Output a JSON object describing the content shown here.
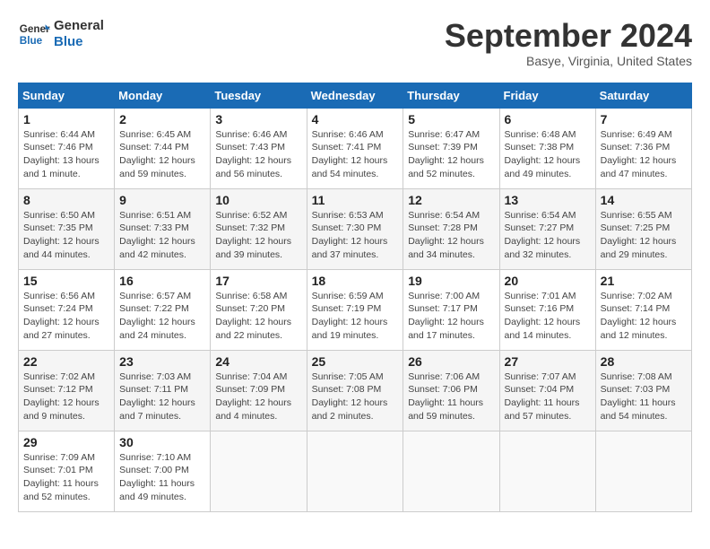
{
  "header": {
    "logo_line1": "General",
    "logo_line2": "Blue",
    "month": "September 2024",
    "location": "Basye, Virginia, United States"
  },
  "weekdays": [
    "Sunday",
    "Monday",
    "Tuesday",
    "Wednesday",
    "Thursday",
    "Friday",
    "Saturday"
  ],
  "weeks": [
    [
      {
        "day": "1",
        "detail": "Sunrise: 6:44 AM\nSunset: 7:46 PM\nDaylight: 13 hours\nand 1 minute."
      },
      {
        "day": "2",
        "detail": "Sunrise: 6:45 AM\nSunset: 7:44 PM\nDaylight: 12 hours\nand 59 minutes."
      },
      {
        "day": "3",
        "detail": "Sunrise: 6:46 AM\nSunset: 7:43 PM\nDaylight: 12 hours\nand 56 minutes."
      },
      {
        "day": "4",
        "detail": "Sunrise: 6:46 AM\nSunset: 7:41 PM\nDaylight: 12 hours\nand 54 minutes."
      },
      {
        "day": "5",
        "detail": "Sunrise: 6:47 AM\nSunset: 7:39 PM\nDaylight: 12 hours\nand 52 minutes."
      },
      {
        "day": "6",
        "detail": "Sunrise: 6:48 AM\nSunset: 7:38 PM\nDaylight: 12 hours\nand 49 minutes."
      },
      {
        "day": "7",
        "detail": "Sunrise: 6:49 AM\nSunset: 7:36 PM\nDaylight: 12 hours\nand 47 minutes."
      }
    ],
    [
      {
        "day": "8",
        "detail": "Sunrise: 6:50 AM\nSunset: 7:35 PM\nDaylight: 12 hours\nand 44 minutes."
      },
      {
        "day": "9",
        "detail": "Sunrise: 6:51 AM\nSunset: 7:33 PM\nDaylight: 12 hours\nand 42 minutes."
      },
      {
        "day": "10",
        "detail": "Sunrise: 6:52 AM\nSunset: 7:32 PM\nDaylight: 12 hours\nand 39 minutes."
      },
      {
        "day": "11",
        "detail": "Sunrise: 6:53 AM\nSunset: 7:30 PM\nDaylight: 12 hours\nand 37 minutes."
      },
      {
        "day": "12",
        "detail": "Sunrise: 6:54 AM\nSunset: 7:28 PM\nDaylight: 12 hours\nand 34 minutes."
      },
      {
        "day": "13",
        "detail": "Sunrise: 6:54 AM\nSunset: 7:27 PM\nDaylight: 12 hours\nand 32 minutes."
      },
      {
        "day": "14",
        "detail": "Sunrise: 6:55 AM\nSunset: 7:25 PM\nDaylight: 12 hours\nand 29 minutes."
      }
    ],
    [
      {
        "day": "15",
        "detail": "Sunrise: 6:56 AM\nSunset: 7:24 PM\nDaylight: 12 hours\nand 27 minutes."
      },
      {
        "day": "16",
        "detail": "Sunrise: 6:57 AM\nSunset: 7:22 PM\nDaylight: 12 hours\nand 24 minutes."
      },
      {
        "day": "17",
        "detail": "Sunrise: 6:58 AM\nSunset: 7:20 PM\nDaylight: 12 hours\nand 22 minutes."
      },
      {
        "day": "18",
        "detail": "Sunrise: 6:59 AM\nSunset: 7:19 PM\nDaylight: 12 hours\nand 19 minutes."
      },
      {
        "day": "19",
        "detail": "Sunrise: 7:00 AM\nSunset: 7:17 PM\nDaylight: 12 hours\nand 17 minutes."
      },
      {
        "day": "20",
        "detail": "Sunrise: 7:01 AM\nSunset: 7:16 PM\nDaylight: 12 hours\nand 14 minutes."
      },
      {
        "day": "21",
        "detail": "Sunrise: 7:02 AM\nSunset: 7:14 PM\nDaylight: 12 hours\nand 12 minutes."
      }
    ],
    [
      {
        "day": "22",
        "detail": "Sunrise: 7:02 AM\nSunset: 7:12 PM\nDaylight: 12 hours\nand 9 minutes."
      },
      {
        "day": "23",
        "detail": "Sunrise: 7:03 AM\nSunset: 7:11 PM\nDaylight: 12 hours\nand 7 minutes."
      },
      {
        "day": "24",
        "detail": "Sunrise: 7:04 AM\nSunset: 7:09 PM\nDaylight: 12 hours\nand 4 minutes."
      },
      {
        "day": "25",
        "detail": "Sunrise: 7:05 AM\nSunset: 7:08 PM\nDaylight: 12 hours\nand 2 minutes."
      },
      {
        "day": "26",
        "detail": "Sunrise: 7:06 AM\nSunset: 7:06 PM\nDaylight: 11 hours\nand 59 minutes."
      },
      {
        "day": "27",
        "detail": "Sunrise: 7:07 AM\nSunset: 7:04 PM\nDaylight: 11 hours\nand 57 minutes."
      },
      {
        "day": "28",
        "detail": "Sunrise: 7:08 AM\nSunset: 7:03 PM\nDaylight: 11 hours\nand 54 minutes."
      }
    ],
    [
      {
        "day": "29",
        "detail": "Sunrise: 7:09 AM\nSunset: 7:01 PM\nDaylight: 11 hours\nand 52 minutes."
      },
      {
        "day": "30",
        "detail": "Sunrise: 7:10 AM\nSunset: 7:00 PM\nDaylight: 11 hours\nand 49 minutes."
      },
      {
        "day": "",
        "detail": ""
      },
      {
        "day": "",
        "detail": ""
      },
      {
        "day": "",
        "detail": ""
      },
      {
        "day": "",
        "detail": ""
      },
      {
        "day": "",
        "detail": ""
      }
    ]
  ]
}
